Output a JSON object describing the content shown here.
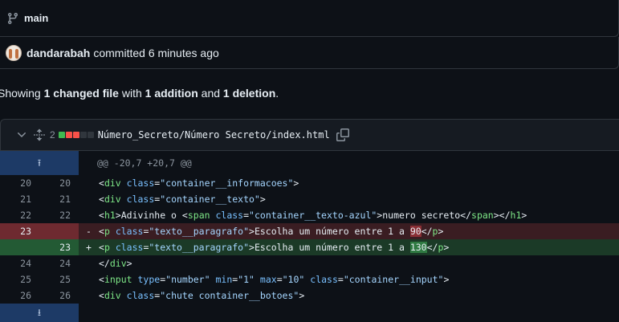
{
  "branch": {
    "name": "main"
  },
  "commit": {
    "author": "dandarabah",
    "action": "committed 6 minutes ago"
  },
  "summary": {
    "prefix": "Showing ",
    "files": "1 changed file",
    "with": " with ",
    "additions": "1 addition",
    "and": " and ",
    "deletions": "1 deletion",
    "end": "."
  },
  "file": {
    "change_count": "2",
    "path": "Número_Secreto/Número Secreto/index.html",
    "diffstat_colors": [
      "#3fb950",
      "#f85149",
      "#f85149",
      "#30363d",
      "#30363d"
    ]
  },
  "hunk_header": "@@ -20,7 +20,7 @@",
  "lines": [
    {
      "old": "20",
      "new": "20",
      "sign": "",
      "type": "ctx"
    },
    {
      "old": "21",
      "new": "21",
      "sign": "",
      "type": "ctx"
    },
    {
      "old": "22",
      "new": "22",
      "sign": "",
      "type": "ctx"
    },
    {
      "old": "23",
      "new": "",
      "sign": "-",
      "type": "del"
    },
    {
      "old": "",
      "new": "23",
      "sign": "+",
      "type": "add"
    },
    {
      "old": "24",
      "new": "24",
      "sign": "",
      "type": "ctx"
    },
    {
      "old": "25",
      "new": "25",
      "sign": "",
      "type": "ctx"
    },
    {
      "old": "26",
      "new": "26",
      "sign": "",
      "type": "ctx"
    }
  ],
  "code": {
    "l20": {
      "indent": "            ",
      "lt": "<",
      "tag": "div",
      "attr": "class",
      "eq": "=",
      "val": "\"container__informacoes\"",
      "gt": ">"
    },
    "l21": {
      "indent": "                ",
      "lt": "<",
      "tag": "div",
      "attr": "class",
      "eq": "=",
      "val": "\"container__texto\"",
      "gt": ">"
    },
    "l22": {
      "indent": "                    ",
      "open": "<",
      "h1": "h1",
      "gt1": ">",
      "text1": "Adivinhe o ",
      "lt2": "<",
      "span": "span",
      "attr": "class",
      "eq": "=",
      "val": "\"container__texto-azul\"",
      "gt2": ">",
      "text2": "numero secreto",
      "close_span": "</",
      "span2": "span",
      "gt3": ">",
      "close_h1": "</",
      "h1b": "h1",
      "gt4": ">"
    },
    "l23_del": {
      "indent": "                    ",
      "lt": "<",
      "tag": "p",
      "attr": "class",
      "eq": "=",
      "val": "\"texto__paragrafo\"",
      "gt": ">",
      "text": "Escolha um número entre 1 a ",
      "num": "90",
      "close": "</",
      "tag2": "p",
      "gt2": ">"
    },
    "l23_add": {
      "indent": "                    ",
      "lt": "<",
      "tag": "p",
      "attr": "class",
      "eq": "=",
      "val": "\"texto__paragrafo\"",
      "gt": ">",
      "text": "Escolha um número entre 1 a ",
      "num": "130",
      "close": "</",
      "tag2": "p",
      "gt2": ">"
    },
    "l24": {
      "indent": "                ",
      "close": "</",
      "tag": "div",
      "gt": ">"
    },
    "l25": {
      "indent": "                ",
      "lt": "<",
      "tag": "input",
      "a1": "type",
      "v1": "\"number\"",
      "a2": "min",
      "v2": "\"1\"",
      "a3": "max",
      "v3": "\"10\"",
      "a4": "class",
      "v4": "\"container__input\"",
      "gt": ">"
    },
    "l26": {
      "indent": "                ",
      "lt": "<",
      "tag": "div",
      "attr": "class",
      "eq": "=",
      "val": "\"chute container__botoes\"",
      "gt": ">"
    }
  },
  "icons": {
    "branch": "git-branch-icon",
    "chevron": "chevron-down-icon",
    "expand": "unfold-icon",
    "copy": "copy-icon",
    "expand_up": "expand-up-icon",
    "expand_down": "expand-down-icon"
  }
}
